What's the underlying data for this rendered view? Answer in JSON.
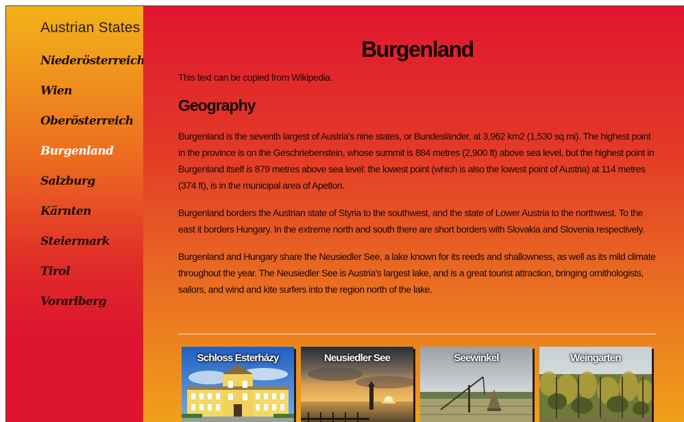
{
  "sidebar": {
    "title": "Austrian States",
    "items": [
      {
        "label": "Niederösterreich"
      },
      {
        "label": "Wien"
      },
      {
        "label": "Oberösterreich"
      },
      {
        "label": "Burgenland",
        "active": true
      },
      {
        "label": "Salzburg"
      },
      {
        "label": "Kärnten"
      },
      {
        "label": "Steiermark"
      },
      {
        "label": "Tirol"
      },
      {
        "label": "Vorarlberg"
      }
    ]
  },
  "main": {
    "title": "Burgenland",
    "intro": "This text can be copied from Wikipedia.",
    "section_heading": "Geography",
    "paragraphs": [
      "Burgenland is the seventh largest of Austria's nine states, or Bundesländer, at 3,962 km2 (1,530 sq mi). The highest point in the province is on the Geschriebenstein, whose summit is 884 metres (2,900 ft) above sea level, but the highest point in Burgenland itself is 879 metres above sea level: the lowest point (which is also the lowest point of Austria) at 114 metres (374 ft), is in the municipal area of Apetlon.",
      "Burgenland borders the Austrian state of Styria to the southwest, and the state of Lower Austria to the northwest. To the east it borders Hungary. In the extreme north and south there are short borders with Slovakia and Slovenia respectively.",
      "Burgenland and Hungary share the Neusiedler See, a lake known for its reeds and shallowness, as well as its mild climate throughout the year. The Neusiedler See is Austria's largest lake, and is a great tourist attraction, bringing ornithologists, sailors, and wind and kite surfers into the region north of the lake."
    ],
    "gallery": [
      {
        "caption": "Schloss Esterházy"
      },
      {
        "caption": "Neusiedler See"
      },
      {
        "caption": "Seewinkel"
      },
      {
        "caption": "Weingarten"
      }
    ]
  },
  "colors": {
    "sidebar_gradient_top": "#f2b31a",
    "sidebar_gradient_bottom": "#dd1530",
    "main_gradient_top": "#e01630",
    "main_gradient_bottom": "#f0a019",
    "active_link": "#ffffff"
  }
}
